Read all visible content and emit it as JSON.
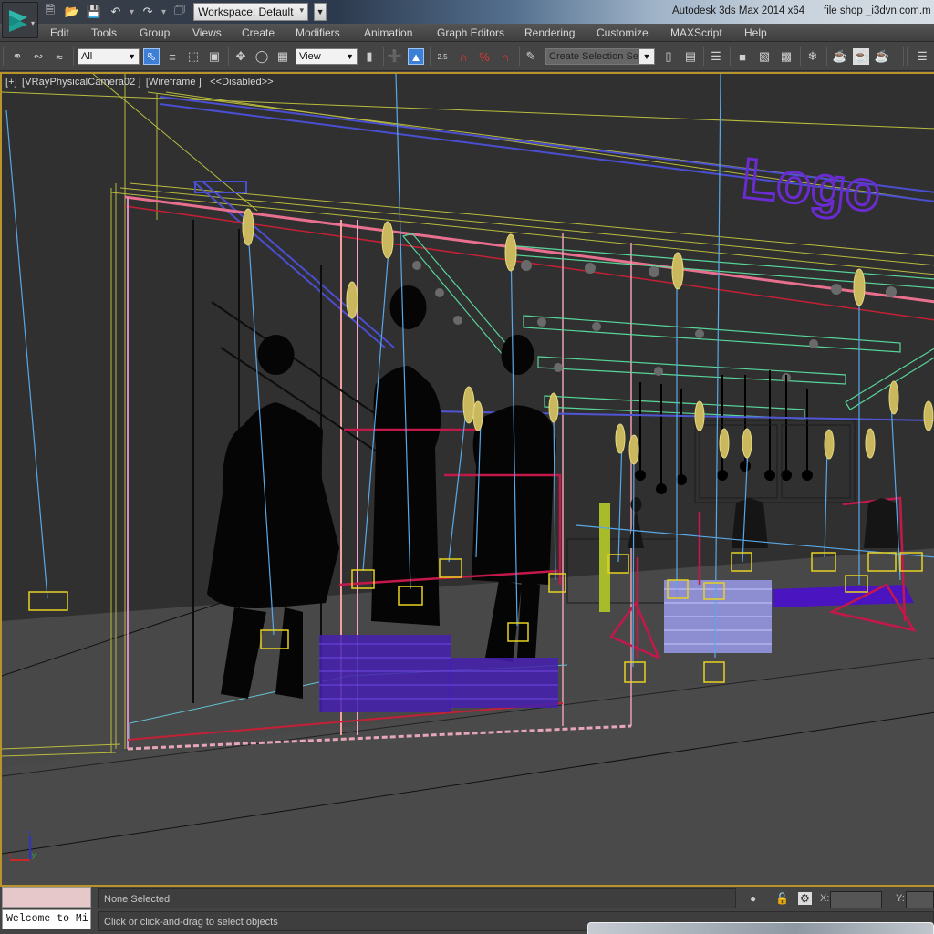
{
  "window": {
    "app_title": "Autodesk 3ds Max  2014 x64",
    "file_title": "file shop _i3dvn.com.m",
    "workspace_label": "Workspace: Default"
  },
  "quick_access": {
    "icons": [
      "new-file-icon",
      "open-file-icon",
      "save-icon",
      "undo-icon",
      "redo-icon",
      "project-folder-icon"
    ]
  },
  "menu": {
    "items": [
      "Edit",
      "Tools",
      "Group",
      "Views",
      "Create",
      "Modifiers",
      "Animation",
      "Graph Editors",
      "Rendering",
      "Customize",
      "MAXScript",
      "Help"
    ]
  },
  "toolbar": {
    "selection_filter": "All",
    "reference_coord": "View",
    "named_selection_placeholder": "Create Selection Se",
    "snap_angle_label": "2.5"
  },
  "viewport": {
    "label_plus": "[+]",
    "label_camera": "[VRayPhysicalCamera02 ]",
    "label_shading": "[Wireframe ]",
    "label_state": "<<Disabled>>",
    "scene_text": "Logo",
    "axis": {
      "x": "x",
      "y": "y",
      "z": "z"
    },
    "colors": {
      "border_active": "#b8942a",
      "background": "#484848",
      "logo": "#6a2bd0"
    }
  },
  "status": {
    "maxscript_listener": "Welcome to Mi",
    "selection": "None Selected",
    "prompt": "Click or click-and-drag to select objects",
    "coord_x_label": "X:",
    "coord_y_label": "Y:",
    "coord_x_value": "",
    "coord_y_value": ""
  }
}
